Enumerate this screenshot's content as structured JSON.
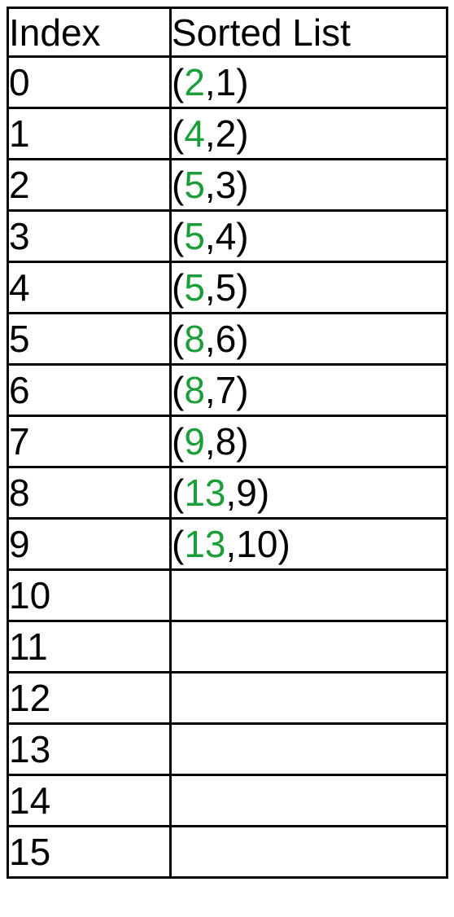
{
  "table": {
    "headers": {
      "index": "Index",
      "sorted_list": "Sorted List"
    },
    "rows": [
      {
        "index": "0",
        "pair": {
          "open": "(",
          "key": "2",
          "sep": ",",
          "val": "1",
          "close": ")"
        }
      },
      {
        "index": "1",
        "pair": {
          "open": "(",
          "key": "4",
          "sep": ",",
          "val": "2",
          "close": ")"
        }
      },
      {
        "index": "2",
        "pair": {
          "open": "(",
          "key": "5",
          "sep": ",",
          "val": "3",
          "close": ")"
        }
      },
      {
        "index": "3",
        "pair": {
          "open": "(",
          "key": "5",
          "sep": ",",
          "val": "4",
          "close": ")"
        }
      },
      {
        "index": "4",
        "pair": {
          "open": "(",
          "key": "5",
          "sep": ",",
          "val": "5",
          "close": ")"
        }
      },
      {
        "index": "5",
        "pair": {
          "open": "(",
          "key": "8",
          "sep": ",",
          "val": "6",
          "close": ")"
        }
      },
      {
        "index": "6",
        "pair": {
          "open": "(",
          "key": "8",
          "sep": ",",
          "val": "7",
          "close": ")"
        }
      },
      {
        "index": "7",
        "pair": {
          "open": "(",
          "key": "9",
          "sep": ",",
          "val": "8",
          "close": ")"
        }
      },
      {
        "index": "8",
        "pair": {
          "open": "(",
          "key": "13",
          "sep": ",",
          "val": "9",
          "close": ")"
        }
      },
      {
        "index": "9",
        "pair": {
          "open": "(",
          "key": "13",
          "sep": ",",
          "val": "10",
          "close": ")"
        }
      },
      {
        "index": "10",
        "pair": null
      },
      {
        "index": "11",
        "pair": null
      },
      {
        "index": "12",
        "pair": null
      },
      {
        "index": "13",
        "pair": null
      },
      {
        "index": "14",
        "pair": null
      },
      {
        "index": "15",
        "pair": null
      }
    ]
  },
  "colors": {
    "key_highlight": "#1b9e3a",
    "text": "#000000",
    "border": "#000000"
  }
}
